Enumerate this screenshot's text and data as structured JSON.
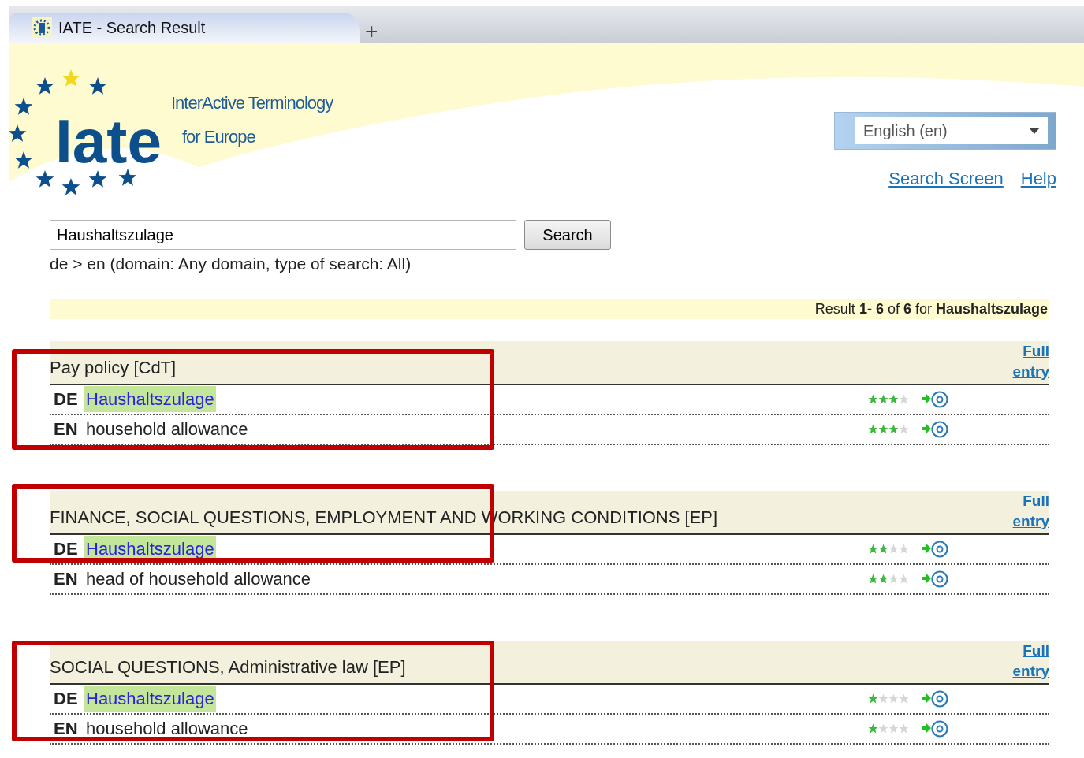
{
  "browser": {
    "tab_title": "IATE - Search Result",
    "new_tab": "+"
  },
  "header": {
    "logo": "Iate",
    "tagline": [
      "InterActive Terminology",
      "for Europe"
    ],
    "language": "English (en)",
    "links": [
      "Search Screen",
      "Help"
    ]
  },
  "search": {
    "value": "Haushaltszulage",
    "button": "Search",
    "info": "de > en (domain: Any domain, type of search: All)"
  },
  "summary": {
    "text": "Result **1- 6** of **6** for **Haushaltszulage**"
  },
  "results": [
    {
      "domain": "Pay policy [CdT]",
      "link": "Full entry",
      "highlighted": true,
      "terms": [
        {
          "lang": "DE",
          "term": "Haushaltszulage",
          "match": true,
          "stars": 3
        },
        {
          "lang": "EN",
          "term": "household allowance",
          "match": false,
          "stars": 3
        }
      ]
    },
    {
      "domain": "FINANCE, SOCIAL QUESTIONS, EMPLOYMENT AND WORKING CONDITIONS [EP]",
      "link": "Full entry",
      "highlighted": true,
      "terms": [
        {
          "lang": "DE",
          "term": "Haushaltszulage",
          "match": true,
          "stars": 2
        },
        {
          "lang": "EN",
          "term": "head of household allowance",
          "match": false,
          "stars": 2
        }
      ]
    },
    {
      "domain": "SOCIAL QUESTIONS, Administrative law [EP]",
      "link": "Full entry",
      "highlighted": true,
      "terms": [
        {
          "lang": "DE",
          "term": "Haushaltszulage",
          "match": true,
          "stars": 1
        },
        {
          "lang": "EN",
          "term": "household allowance",
          "match": false,
          "stars": 1
        }
      ]
    }
  ]
}
